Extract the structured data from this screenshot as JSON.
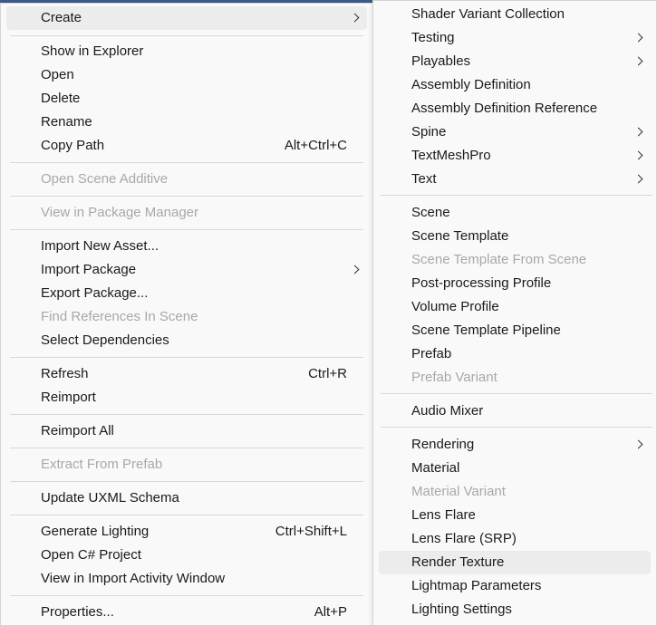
{
  "main_menu": {
    "create": "Create",
    "show_in_explorer": "Show in Explorer",
    "open": "Open",
    "delete": "Delete",
    "rename": "Rename",
    "copy_path": "Copy Path",
    "copy_path_shortcut": "Alt+Ctrl+C",
    "open_scene_additive": "Open Scene Additive",
    "view_in_package_manager": "View in Package Manager",
    "import_new_asset": "Import New Asset...",
    "import_package": "Import Package",
    "export_package": "Export Package...",
    "find_references_in_scene": "Find References In Scene",
    "select_dependencies": "Select Dependencies",
    "refresh": "Refresh",
    "refresh_shortcut": "Ctrl+R",
    "reimport": "Reimport",
    "reimport_all": "Reimport All",
    "extract_from_prefab": "Extract From Prefab",
    "update_uxml_schema": "Update UXML Schema",
    "generate_lighting": "Generate Lighting",
    "generate_lighting_shortcut": "Ctrl+Shift+L",
    "open_csharp_project": "Open C# Project",
    "view_in_import_activity_window": "View in Import Activity Window",
    "properties": "Properties...",
    "properties_shortcut": "Alt+P"
  },
  "sub_menu": {
    "shader_variant_collection": "Shader Variant Collection",
    "testing": "Testing",
    "playables": "Playables",
    "assembly_definition": "Assembly Definition",
    "assembly_definition_reference": "Assembly Definition Reference",
    "spine": "Spine",
    "textmeshpro": "TextMeshPro",
    "text": "Text",
    "scene": "Scene",
    "scene_template": "Scene Template",
    "scene_template_from_scene": "Scene Template From Scene",
    "post_processing_profile": "Post-processing Profile",
    "volume_profile": "Volume Profile",
    "scene_template_pipeline": "Scene Template Pipeline",
    "prefab": "Prefab",
    "prefab_variant": "Prefab Variant",
    "audio_mixer": "Audio Mixer",
    "rendering": "Rendering",
    "material": "Material",
    "material_variant": "Material Variant",
    "lens_flare": "Lens Flare",
    "lens_flare_srp": "Lens Flare (SRP)",
    "render_texture": "Render Texture",
    "lightmap_parameters": "Lightmap Parameters",
    "lighting_settings": "Lighting Settings"
  }
}
